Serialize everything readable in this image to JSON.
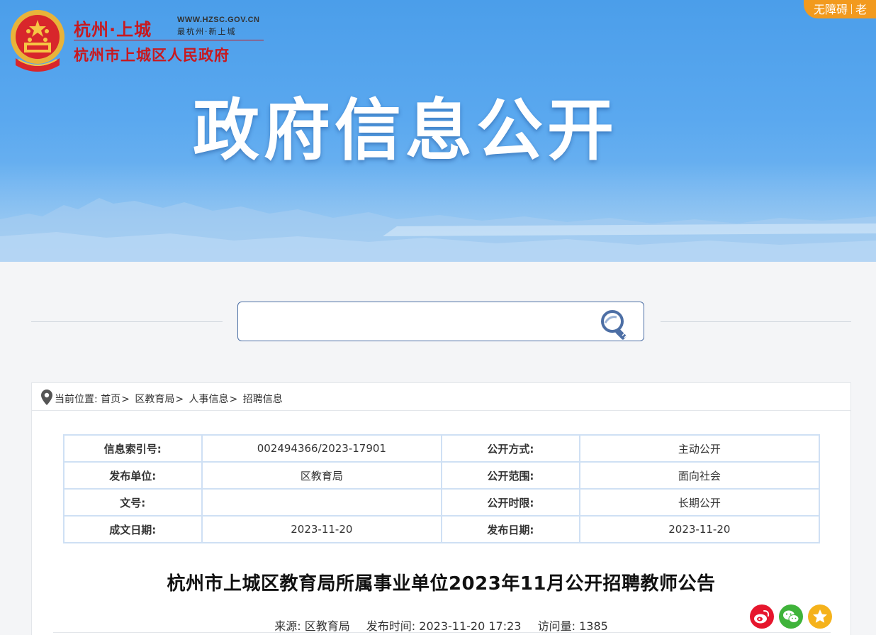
{
  "header": {
    "logo_line1": "杭州·上城",
    "logo_url": "WWW.HZSC.GOV.CN",
    "logo_slogan": "最杭州·新上城",
    "logo_line2": "杭州市上城区人民政府",
    "hero_title": "政府信息公开",
    "accessibility_label": "无障碍",
    "elder_label": "老"
  },
  "search": {
    "placeholder": ""
  },
  "breadcrumb": {
    "prefix": "当前位置:",
    "items": [
      "首页",
      "区教育局",
      "人事信息",
      "招聘信息"
    ],
    "separator": ">"
  },
  "meta_table": {
    "rows": [
      {
        "k1": "信息索引号:",
        "v1": "002494366/2023-17901",
        "k2": "公开方式:",
        "v2": "主动公开"
      },
      {
        "k1": "发布单位:",
        "v1": "区教育局",
        "k2": "公开范围:",
        "v2": "面向社会"
      },
      {
        "k1": "文号:",
        "v1": "",
        "k2": "公开时限:",
        "v2": "长期公开"
      },
      {
        "k1": "成文日期:",
        "v1": "2023-11-20",
        "k2": "发布日期:",
        "v2": "2023-11-20"
      }
    ]
  },
  "article": {
    "title": "杭州市上城区教育局所属事业单位2023年11月公开招聘教师公告",
    "source_label": "来源:",
    "source_value": "区教育局",
    "time_label": "发布时间:",
    "time_value": "2023-11-20 17:23",
    "visits_label": "访问量:",
    "visits_value": "1385"
  },
  "colors": {
    "brand_red": "#c8191f",
    "banner_blue": "#5aa8ef",
    "accent_orange": "#f29a1e",
    "table_border": "#cfe0f4",
    "weibo_red": "#e6162d",
    "wechat_green": "#3fb33a",
    "fav_yellow": "#f5b21b"
  },
  "share_icons": [
    "weibo-icon",
    "wechat-icon",
    "favorite-star-icon"
  ]
}
